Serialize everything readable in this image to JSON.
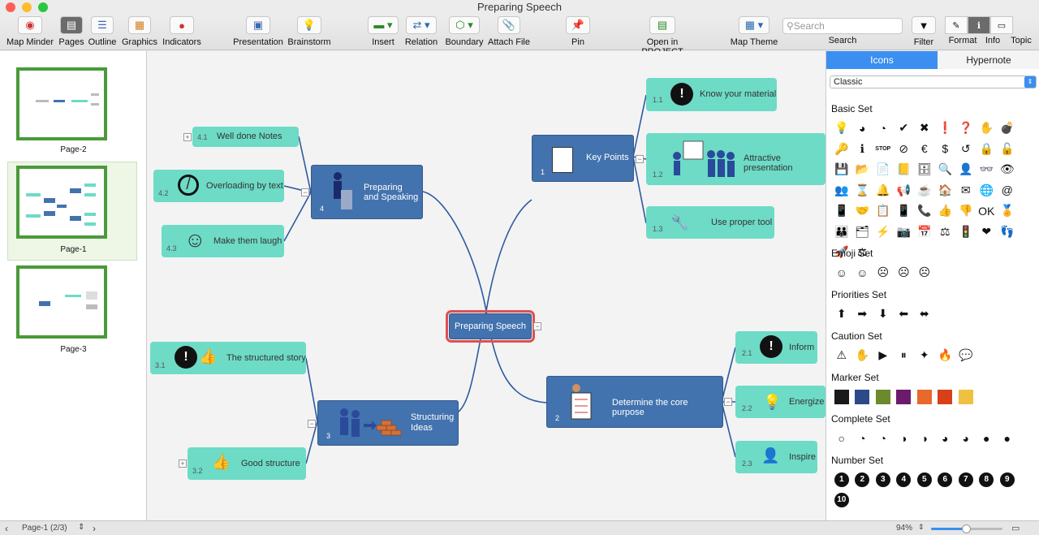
{
  "window": {
    "title": "Preparing Speech"
  },
  "toolbar": {
    "map_minder": "Map Minder",
    "pages": "Pages",
    "outline": "Outline",
    "graphics": "Graphics",
    "indicators": "Indicators",
    "presentation": "Presentation",
    "brainstorm": "Brainstorm",
    "insert": "Insert",
    "relation": "Relation",
    "boundary": "Boundary",
    "attach_file": "Attach File",
    "pin": "Pin",
    "open_in_project": "Open in PROJECT",
    "map_theme": "Map Theme",
    "search_placeholder": "Search",
    "search": "Search",
    "filter": "Filter",
    "format": "Format",
    "info": "Info",
    "topic": "Topic"
  },
  "pages": [
    {
      "label": "Page-2"
    },
    {
      "label": "Page-1"
    },
    {
      "label": "Page-3"
    }
  ],
  "map": {
    "central": "Preparing Speech",
    "key_points": {
      "num": "1",
      "label": "Key Points",
      "children": [
        {
          "num": "1.1",
          "label": "Know your material"
        },
        {
          "num": "1.2",
          "label": "Attractive presentation"
        },
        {
          "num": "1.3",
          "label": "Use proper tool"
        }
      ]
    },
    "core_purpose": {
      "num": "2",
      "label": "Determine the core purpose",
      "children": [
        {
          "num": "2.1",
          "label": "Inform"
        },
        {
          "num": "2.2",
          "label": "Energize"
        },
        {
          "num": "2.3",
          "label": "Inspire"
        }
      ]
    },
    "structuring": {
      "num": "3",
      "label1": "Structuring",
      "label2": "Ideas",
      "children": [
        {
          "num": "3.1",
          "label": "The structured story"
        },
        {
          "num": "3.2",
          "label": "Good structure"
        }
      ]
    },
    "preparing": {
      "num": "4",
      "label1": "Preparing",
      "label2": "and Speaking",
      "children": [
        {
          "num": "4.1",
          "label": "Well done Notes"
        },
        {
          "num": "4.2",
          "label": "Overloading by text"
        },
        {
          "num": "4.3",
          "label": "Make them laugh"
        }
      ]
    }
  },
  "panel": {
    "tabs": {
      "icons": "Icons",
      "hypernote": "Hypernote"
    },
    "dropdown": "Classic",
    "sets": {
      "basic": "Basic Set",
      "emoji": "Emoji Set",
      "priorities": "Priorities Set",
      "caution": "Caution Set",
      "marker": "Marker Set",
      "complete": "Complete Set",
      "number": "Number Set"
    },
    "basic_icons": [
      "💡",
      "◕",
      "◔",
      "✔",
      "✖",
      "❗",
      "❓",
      "✋",
      "💣",
      "🔑",
      "ℹ",
      "STOP",
      "⊘",
      "€",
      "$",
      "↺",
      "🔒",
      "🔓",
      "💾",
      "📂",
      "📄",
      "📒",
      "🗄",
      "🔍",
      "👤",
      "👓",
      "👁",
      "👥",
      "⌛",
      "🔔",
      "📢",
      "☕",
      "🏠",
      "✉",
      "🌐",
      "@",
      "📱",
      "🤝",
      "📋",
      "📱",
      "📞",
      "👍",
      "👎",
      "OK",
      "🏅",
      "👪",
      "🗂",
      "⚡",
      "📷",
      "📅",
      "⚖",
      "🚦",
      "❤",
      "👣",
      "🚀",
      "⚖"
    ],
    "emoji_icons": [
      "☺",
      "☺",
      "☹",
      "☹",
      "☹"
    ],
    "priority_icons": [
      "⬆",
      "➡",
      "⬇",
      "⬅",
      "⬌"
    ],
    "caution_icons": [
      "⚠",
      "✋",
      "▶",
      "⏸",
      "✦",
      "🔥",
      "💬"
    ],
    "marker_colors": [
      "#1a1a1a",
      "#2c4a8a",
      "#6c8a2c",
      "#6c1a6c",
      "#e8692c",
      "#d8401a",
      "#f0c040"
    ],
    "complete_icons": [
      "○",
      "◔",
      "◔",
      "◑",
      "◑",
      "◕",
      "◕",
      "●",
      "●"
    ],
    "number_icons": [
      "1",
      "2",
      "3",
      "4",
      "5",
      "6",
      "7",
      "8",
      "9",
      "10"
    ]
  },
  "status": {
    "page": "Page-1 (2/3)",
    "zoom": "94%"
  }
}
